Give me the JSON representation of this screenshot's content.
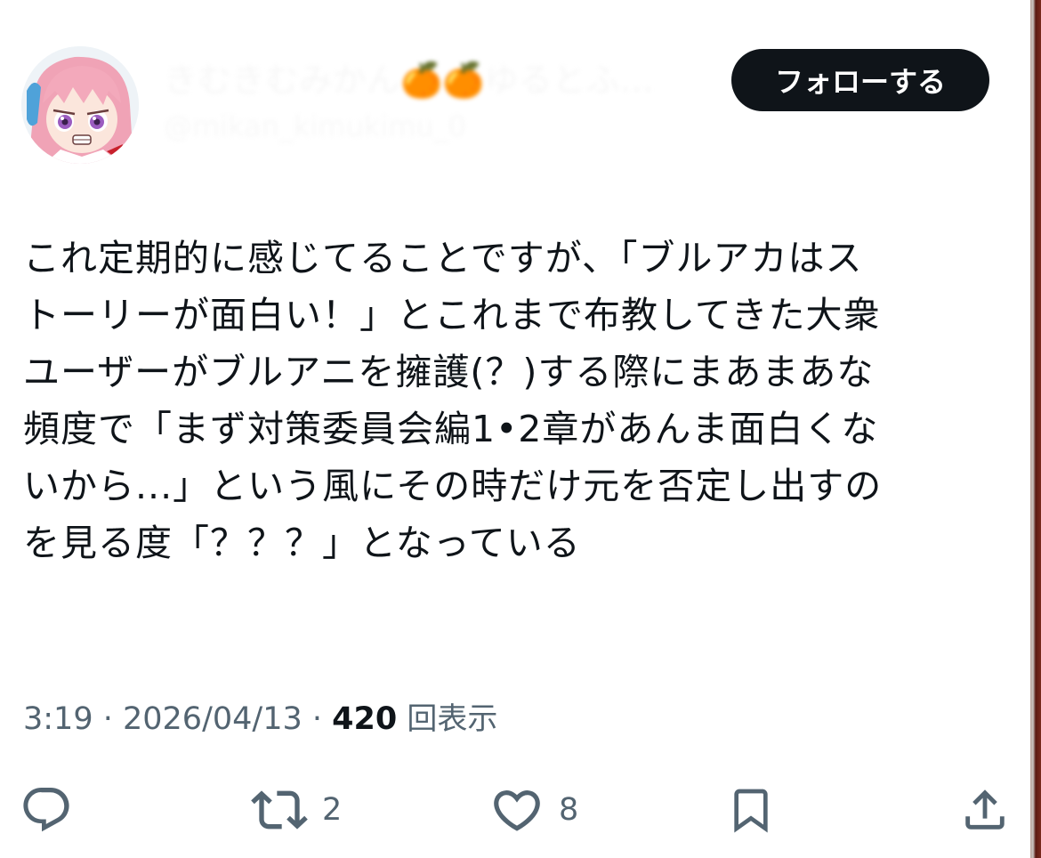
{
  "tweet": {
    "author": {
      "display_name": "きむきむみかん🍊🍊ゆるとふ…",
      "handle": "@mikan_kimukimu_0"
    },
    "follow_label": "フォローする",
    "text": "これ定期的に感じてることですが、「ブルアカはス\nトーリーが面白い！」とこれまで布教してきた大衆\nユーザーがブルアニを擁護(？)する際にまあまあな\n頻度で「まず対策委員会編1•2章があんま面白くな\nいから...」という風にその時だけ元を否定し出すの\nを見る度「？？？」となっている",
    "time": "3:19",
    "separator": " · ",
    "date": "2026/04/13",
    "views_count": "420",
    "views_label": "回表示"
  },
  "actions": {
    "reply": {
      "icon": "reply-icon",
      "count": ""
    },
    "retweet": {
      "icon": "retweet-icon",
      "count": "2"
    },
    "like": {
      "icon": "heart-icon",
      "count": "8"
    },
    "bookmark": {
      "icon": "bookmark-icon"
    },
    "share": {
      "icon": "share-icon"
    }
  },
  "colors": {
    "text": "#0f1419",
    "secondary": "#536471",
    "follow_bg": "#0f1419",
    "follow_text": "#ffffff"
  }
}
